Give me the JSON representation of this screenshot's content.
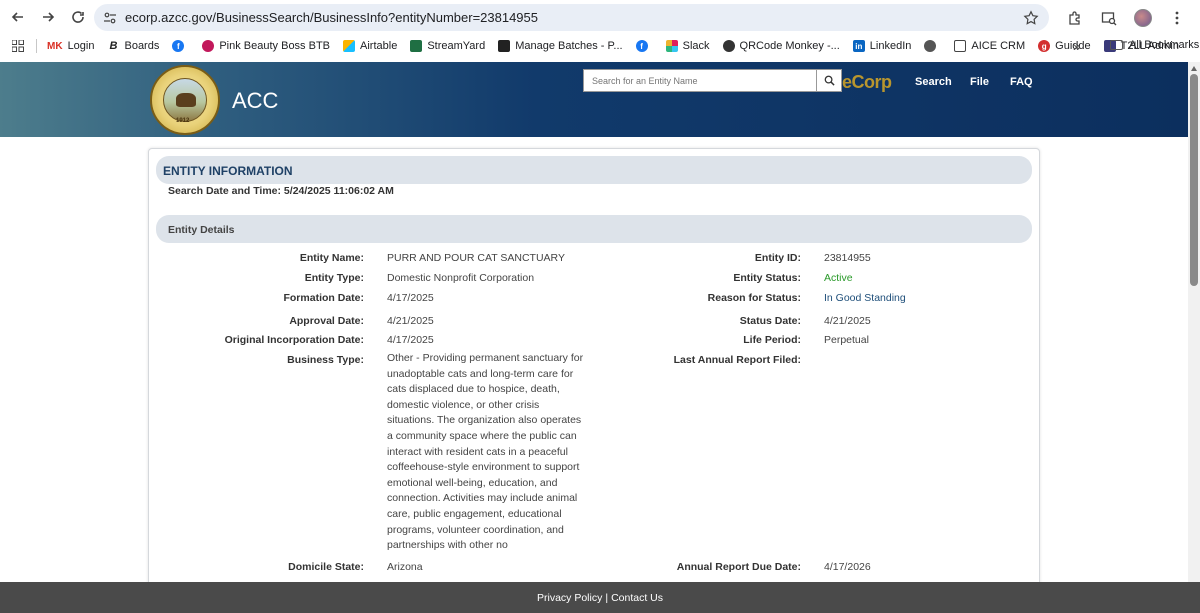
{
  "browser": {
    "url": "ecorp.azcc.gov/BusinessSearch/BusinessInfo?entityNumber=23814955",
    "bookmarks": [
      {
        "label": "Login",
        "prefix": "MK",
        "color": "#d93025"
      },
      {
        "label": "Boards",
        "prefix": "B",
        "color": "#222222"
      },
      {
        "label": "",
        "prefix": "f",
        "color": "#1877f2"
      },
      {
        "label": "Pink Beauty Boss BTB",
        "prefix": "",
        "color": "#c2185b"
      },
      {
        "label": "Airtable",
        "prefix": "",
        "color": "#fcb400"
      },
      {
        "label": "StreamYard",
        "prefix": "",
        "color": "#1f6f43"
      },
      {
        "label": "Manage Batches - P...",
        "prefix": "",
        "color": "#222222"
      },
      {
        "label": "",
        "prefix": "f",
        "color": "#1877f2"
      },
      {
        "label": "Slack",
        "prefix": "",
        "color": "#e01e5a"
      },
      {
        "label": "QRCode Monkey -...",
        "prefix": "",
        "color": "#333333"
      },
      {
        "label": "LinkedIn",
        "prefix": "in",
        "color": "#0a66c2"
      },
      {
        "label": "",
        "prefix": "",
        "color": "#555555"
      },
      {
        "label": "AICE CRM",
        "prefix": "",
        "color": "#444444"
      },
      {
        "label": "Guidde",
        "prefix": "g",
        "color": "#d32f2f"
      },
      {
        "label": "T2LL Admin",
        "prefix": "",
        "color": "#3a3a7a"
      }
    ],
    "all_bookmarks": "All Bookmarks"
  },
  "header": {
    "seal_year": "1912",
    "title": "ACC",
    "search_placeholder": "Search for an Entity Name",
    "brand": "eCorp",
    "nav": [
      "Search",
      "File",
      "FAQ"
    ]
  },
  "entity_info": {
    "title": "ENTITY INFORMATION",
    "search_date": "Search Date and Time: 5/24/2025 11:06:02 AM"
  },
  "details": {
    "title": "Entity Details",
    "left": [
      {
        "label": "Entity Name:",
        "value": "PURR AND POUR CAT SANCTUARY"
      },
      {
        "label": "Entity Type:",
        "value": "Domestic Nonprofit Corporation"
      },
      {
        "label": "Formation Date:",
        "value": "4/17/2025"
      },
      {
        "label": "Approval Date:",
        "value": "4/21/2025"
      },
      {
        "label": "Original Incorporation Date:",
        "value": "4/17/2025"
      },
      {
        "label": "Business Type:",
        "value": "Other - Providing permanent sanctuary for unadoptable cats and long-term care for cats displaced due to hospice, death, domestic violence, or other crisis situations. The organization also operates a community space where the public can interact with resident cats in a peaceful coffeehouse-style environment to support emotional well-being, education, and connection. Activities may include animal care, public engagement, educational programs, volunteer coordination, and partnerships with other no"
      },
      {
        "label": "Domicile State:",
        "value": "Arizona"
      }
    ],
    "right": [
      {
        "label": "Entity ID:",
        "value": "23814955"
      },
      {
        "label": "Entity Status:",
        "value": "Active"
      },
      {
        "label": "Reason for Status:",
        "value": "In Good Standing"
      },
      {
        "label": "Status Date:",
        "value": "4/21/2025"
      },
      {
        "label": "Life Period:",
        "value": "Perpetual"
      },
      {
        "label": "Last Annual Report Filed:",
        "value": ""
      },
      {
        "label": "Annual Report Due Date:",
        "value": "4/17/2026"
      }
    ]
  },
  "footer": {
    "privacy": "Privacy Policy",
    "separator": "|",
    "contact": "Contact Us"
  },
  "colors": {
    "header_dark": "#0c2f5e",
    "brand_gold": "#b9962e",
    "status_active": "#2a9a2a",
    "status_reason": "#1f4f7a",
    "footer": "#4a4a4a"
  }
}
